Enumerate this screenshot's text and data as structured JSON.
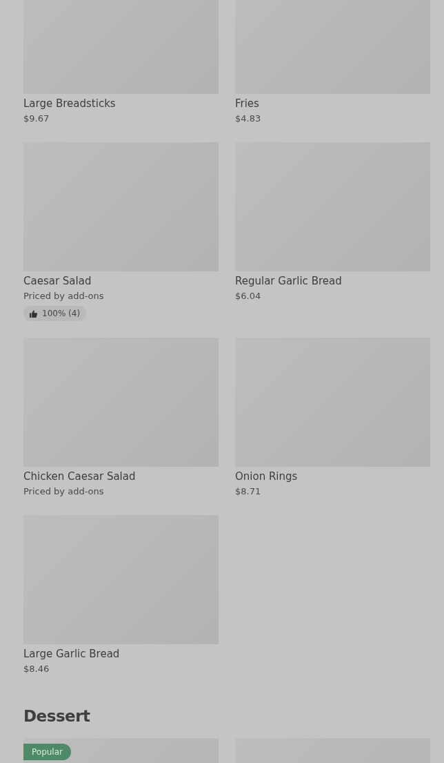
{
  "sections": [
    {
      "items": [
        {
          "kind": "picture",
          "name": "Large Breadsticks",
          "price": "$9.67"
        },
        {
          "kind": "picture",
          "name": "Fries",
          "price": "$4.83"
        },
        {
          "kind": "picture",
          "name": "Caesar Salad",
          "price": "Priced by add-ons",
          "rating": "100% (4)"
        },
        {
          "kind": "picture",
          "name": "Regular Garlic Bread",
          "price": "$6.04"
        },
        {
          "kind": "picture",
          "name": "Chicken Caesar Salad",
          "price": "Priced by add-ons"
        },
        {
          "kind": "picture",
          "name": "Onion Rings",
          "price": "$8.71"
        },
        {
          "kind": "picture",
          "name": "Large Garlic Bread",
          "price": "$8.46"
        }
      ]
    },
    {
      "title": "Dessert",
      "items": [
        {
          "kind": "picture",
          "badge": "Popular"
        },
        {
          "kind": "picture"
        }
      ]
    }
  ]
}
